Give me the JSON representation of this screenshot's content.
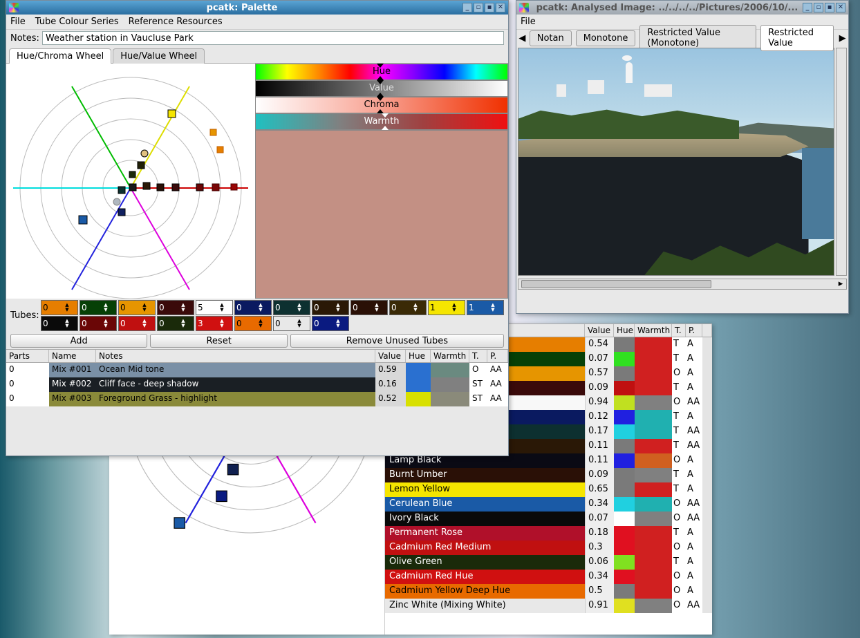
{
  "palette_window": {
    "title": "pcatk: Palette",
    "menu": [
      "File",
      "Tube Colour Series",
      "Reference Resources"
    ],
    "notes_label": "Notes:",
    "notes_value": "Weather station in Vaucluse Park",
    "wheel_tabs": [
      "Hue/Chroma Wheel",
      "Hue/Value Wheel"
    ],
    "active_wheel_tab": 0,
    "sliders": [
      {
        "label": "Hue",
        "type": "hue"
      },
      {
        "label": "Value",
        "type": "value"
      },
      {
        "label": "Chroma",
        "type": "chroma"
      },
      {
        "label": "Warmth",
        "type": "warmth"
      }
    ],
    "swatch_big": "#c39084",
    "tubes_label": "Tubes:",
    "tubes": [
      {
        "bg": "#e67e00",
        "fg": "#000",
        "val": "0"
      },
      {
        "bg": "#064006",
        "fg": "#fff",
        "val": "0"
      },
      {
        "bg": "#e69500",
        "fg": "#000",
        "val": "0"
      },
      {
        "bg": "#3a0a0a",
        "fg": "#fff",
        "val": "0"
      },
      {
        "bg": "#ffffff",
        "fg": "#000",
        "val": "5"
      },
      {
        "bg": "#0a1a60",
        "fg": "#fff",
        "val": "0"
      },
      {
        "bg": "#0d3030",
        "fg": "#fff",
        "val": "0"
      },
      {
        "bg": "#2a1806",
        "fg": "#fff",
        "val": "0"
      },
      {
        "bg": "#2a1006",
        "fg": "#fff",
        "val": "0"
      },
      {
        "bg": "#3a2a06",
        "fg": "#fff",
        "val": "0"
      },
      {
        "bg": "#f5e500",
        "fg": "#000",
        "val": "1"
      },
      {
        "bg": "#1a5aa6",
        "fg": "#fff",
        "val": "1"
      },
      {
        "bg": "#0a0a0a",
        "fg": "#fff",
        "val": "0"
      },
      {
        "bg": "#6a0606",
        "fg": "#fff",
        "val": "0"
      },
      {
        "bg": "#c01010",
        "fg": "#fff",
        "val": "0"
      },
      {
        "bg": "#1a2a0a",
        "fg": "#fff",
        "val": "0"
      },
      {
        "bg": "#d01010",
        "fg": "#fff",
        "val": "3"
      },
      {
        "bg": "#e86a00",
        "fg": "#000",
        "val": "0"
      },
      {
        "bg": "#e8e8e8",
        "fg": "#000",
        "val": "0"
      },
      {
        "bg": "#0a1a80",
        "fg": "#fff",
        "val": "0"
      }
    ],
    "tube_cols_per_row": 12,
    "buttons": {
      "add": "Add",
      "reset": "Reset",
      "remove": "Remove Unused Tubes"
    },
    "mix_headers": [
      "Parts",
      "Name",
      "Notes",
      "Value",
      "Hue",
      "Warmth",
      "T.",
      "P."
    ],
    "mixes": [
      {
        "parts": "0",
        "name": "Mix #001",
        "notes": "Ocean Mid tone",
        "value": "0.59",
        "hue": "#2a70d0",
        "warmth": "#6a8a80",
        "t": "O",
        "p": "AA",
        "rowbg": "#7a90a6",
        "rowfg": "#000"
      },
      {
        "parts": "0",
        "name": "Mix #002",
        "notes": "Cliff face - deep shadow",
        "value": "0.16",
        "hue": "#2a70d0",
        "warmth": "#808080",
        "t": "ST",
        "p": "AA",
        "rowbg": "#1a1f24",
        "rowfg": "#fff"
      },
      {
        "parts": "0",
        "name": "Mix #003",
        "notes": "Foreground Grass - highlight",
        "value": "0.52",
        "hue": "#d8e000",
        "warmth": "#8a8a7a",
        "t": "ST",
        "p": "AA",
        "rowbg": "#8a8a3a",
        "rowfg": "#000"
      }
    ]
  },
  "image_window": {
    "title": "pcatk: Analysed Image: ../../../../Pictures/2006/10/...",
    "menu": [
      "File"
    ],
    "tabs": [
      "Notan",
      "Monotone",
      "Restricted Value (Monotone)",
      "Restricted Value"
    ],
    "active_tab": 3
  },
  "colour_table": {
    "headers": [
      "Value",
      "Hue",
      "Warmth",
      "T.",
      "P."
    ],
    "rows": [
      {
        "name": "",
        "bg": "#e67e00",
        "fg": "#000",
        "value": "0.54",
        "hue": "#7a7a7a",
        "warmth": "#d02020",
        "t": "T",
        "p": "A"
      },
      {
        "name": "",
        "bg": "#064006",
        "fg": "#fff",
        "value": "0.07",
        "hue": "#30e020",
        "warmth": "#d02020",
        "t": "T",
        "p": "A"
      },
      {
        "name": "",
        "bg": "#e69500",
        "fg": "#000",
        "value": "0.57",
        "hue": "#7a7a7a",
        "warmth": "#d02020",
        "t": "O",
        "p": "A"
      },
      {
        "name": "",
        "bg": "#3a0a0a",
        "fg": "#fff",
        "value": "0.09",
        "hue": "#c01010",
        "warmth": "#d02020",
        "t": "T",
        "p": "A"
      },
      {
        "name": "",
        "bg": "#f8f8f8",
        "fg": "#000",
        "value": "0.94",
        "hue": "#c0e020",
        "warmth": "#808080",
        "t": "O",
        "p": "AA"
      },
      {
        "name": "",
        "bg": "#0a1a60",
        "fg": "#fff",
        "value": "0.12",
        "hue": "#2020e0",
        "warmth": "#20b0b0",
        "t": "T",
        "p": "A"
      },
      {
        "name": "",
        "bg": "#0d3030",
        "fg": "#fff",
        "value": "0.17",
        "hue": "#20d0e0",
        "warmth": "#20b0b0",
        "t": "T",
        "p": "AA"
      },
      {
        "name": "",
        "bg": "#2a1806",
        "fg": "#fff",
        "value": "0.11",
        "hue": "#7a7a7a",
        "warmth": "#d02020",
        "t": "T",
        "p": "AA"
      },
      {
        "name": "Lamp Black",
        "bg": "#0a0a14",
        "fg": "#fff",
        "value": "0.11",
        "hue": "#2020e0",
        "warmth": "#d06020",
        "t": "O",
        "p": "A"
      },
      {
        "name": "Burnt Umber",
        "bg": "#2a1006",
        "fg": "#fff",
        "value": "0.09",
        "hue": "#7a7a7a",
        "warmth": "#808080",
        "t": "T",
        "p": "A"
      },
      {
        "name": "Lemon Yellow",
        "bg": "#f5e500",
        "fg": "#000",
        "value": "0.65",
        "hue": "#7a7a7a",
        "warmth": "#d02020",
        "t": "T",
        "p": "A"
      },
      {
        "name": "Cerulean Blue",
        "bg": "#1a5aa6",
        "fg": "#fff",
        "value": "0.34",
        "hue": "#20d0e0",
        "warmth": "#20b0b0",
        "t": "O",
        "p": "AA"
      },
      {
        "name": "Ivory Black",
        "bg": "#0a0a0a",
        "fg": "#fff",
        "value": "0.07",
        "hue": "#ffffff",
        "warmth": "#808080",
        "t": "O",
        "p": "AA"
      },
      {
        "name": "Permanent Rose",
        "bg": "#b0102a",
        "fg": "#fff",
        "value": "0.18",
        "hue": "#e01020",
        "warmth": "#d02020",
        "t": "T",
        "p": "A"
      },
      {
        "name": "Cadmium Red Medium",
        "bg": "#c01010",
        "fg": "#fff",
        "value": "0.3",
        "hue": "#e01020",
        "warmth": "#d02020",
        "t": "O",
        "p": "A"
      },
      {
        "name": "Olive Green",
        "bg": "#1a2a0a",
        "fg": "#fff",
        "value": "0.06",
        "hue": "#80e020",
        "warmth": "#d02020",
        "t": "T",
        "p": "A"
      },
      {
        "name": "Cadmium Red Hue",
        "bg": "#d01010",
        "fg": "#fff",
        "value": "0.34",
        "hue": "#e01020",
        "warmth": "#d02020",
        "t": "O",
        "p": "A"
      },
      {
        "name": "Cadmium Yellow Deep Hue",
        "bg": "#e86a00",
        "fg": "#000",
        "value": "0.5",
        "hue": "#7a7a7a",
        "warmth": "#d02020",
        "t": "O",
        "p": "A"
      },
      {
        "name": "Zinc White (Mixing White)",
        "bg": "#e8e8e8",
        "fg": "#000",
        "value": "0.91",
        "hue": "#e0e020",
        "warmth": "#808080",
        "t": "O",
        "p": "AA"
      }
    ]
  }
}
